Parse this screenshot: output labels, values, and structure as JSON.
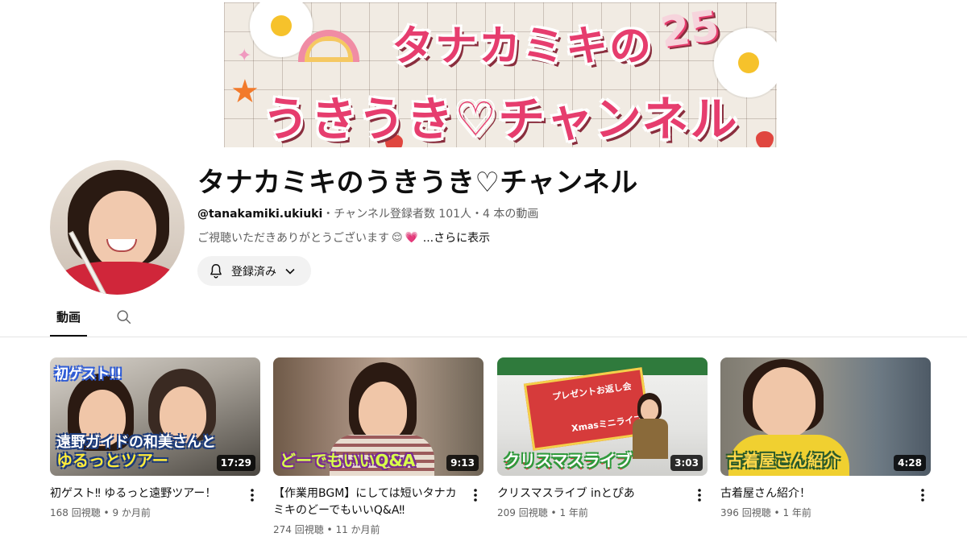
{
  "banner": {
    "line1": "タナカミキの",
    "line2": "うきうき♡チャンネル",
    "badge": "25"
  },
  "channel": {
    "name": "タナカミキのうきうき♡チャンネル",
    "handle": "@tanakamiki.ukiuki",
    "subscribers": "チャンネル登録者数 101人",
    "video_count": "4 本の動画",
    "separator": "・",
    "description": "ご視聴いただきありがとうございます",
    "description_emoji_1": "😌",
    "description_emoji_2": "💗",
    "more_label": "...さらに表示",
    "subscribe_label": "登録済み"
  },
  "tabs": [
    {
      "label": "動画"
    }
  ],
  "videos": [
    {
      "title": "初ゲスト‼ ゆるっと遠野ツアー！",
      "views": "168 回視聴",
      "age": "9 か月前",
      "duration": "17:29",
      "thumb_tag": "初ゲスト!!",
      "thumb_caption_top": "遠野ガイドの和美さんと",
      "thumb_caption": "ゆるっとツアー"
    },
    {
      "title": "【作業用BGM】にしては短いタナカミキのどーでもいいQ&A‼",
      "views": "274 回視聴",
      "age": "11 か月前",
      "duration": "9:13",
      "thumb_caption": "どーでもいいQ&A"
    },
    {
      "title": "クリスマスライブ inとぴあ",
      "views": "209 回視聴",
      "age": "1 年前",
      "duration": "3:03",
      "thumb_caption": "クリスマスライブ",
      "thumb_sign": "プレゼントお返し会",
      "thumb_sign2": "Xmasミニライブ"
    },
    {
      "title": "古着屋さん紹介！",
      "views": "396 回視聴",
      "age": "1 年前",
      "duration": "4:28",
      "thumb_caption": "古着屋さん紹介"
    }
  ],
  "meta_separator": " • "
}
